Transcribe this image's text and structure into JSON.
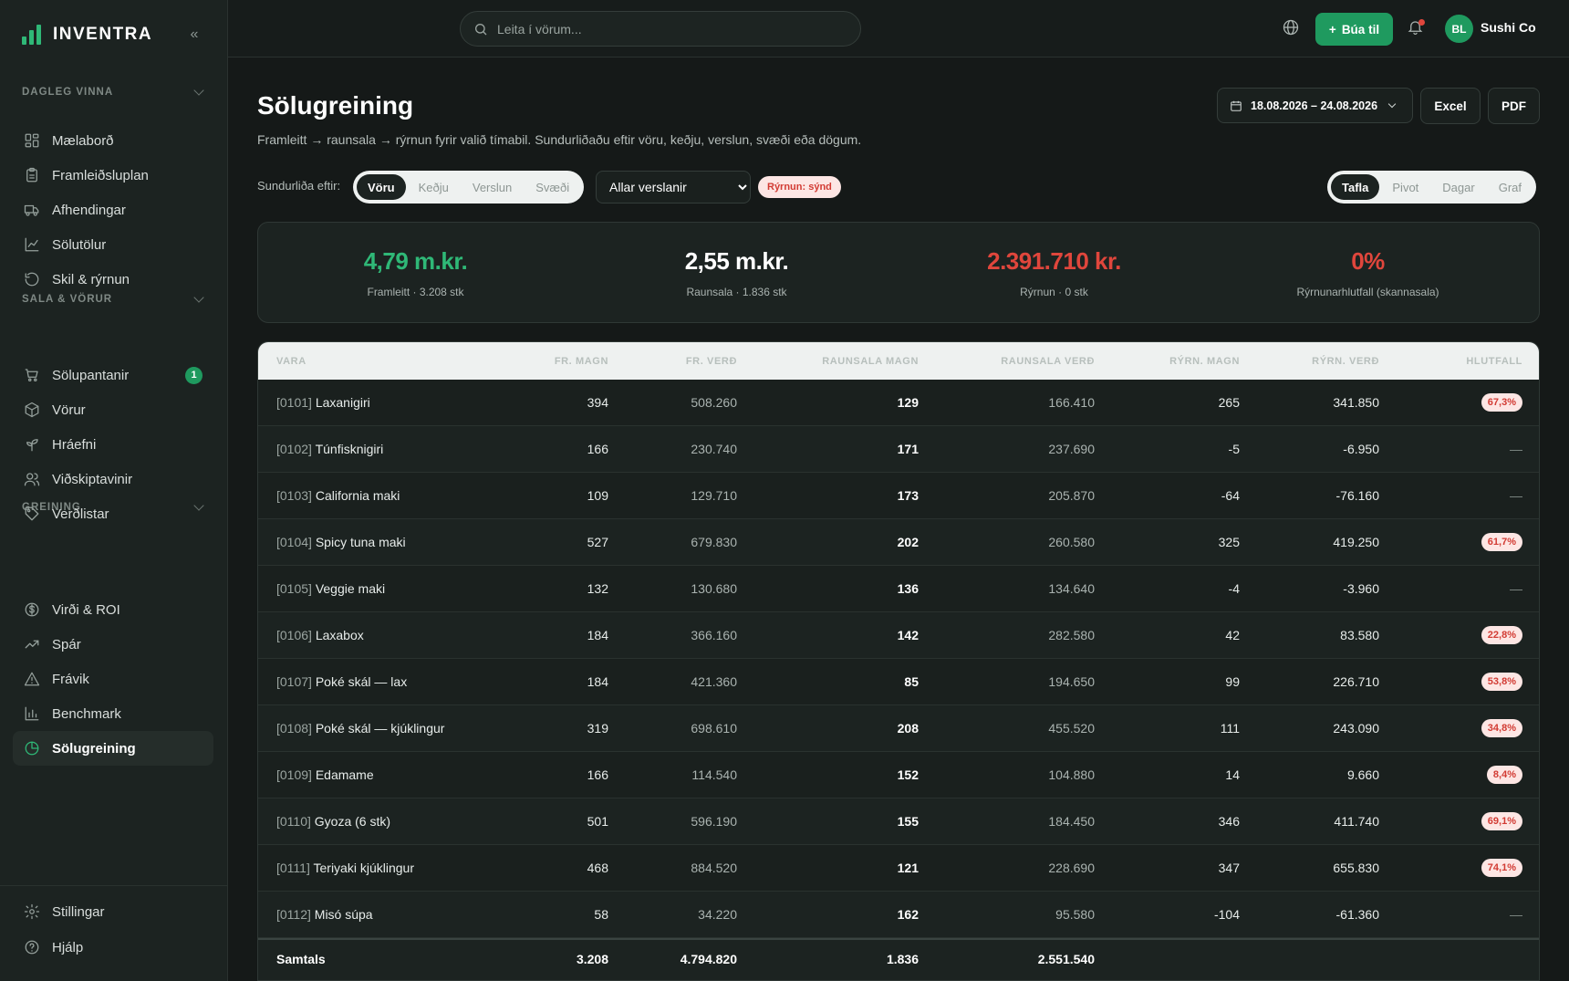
{
  "brand": {
    "name": "INVENTRA"
  },
  "sidebar": {
    "sections": [
      {
        "title": "DAGLEG VINNA"
      },
      {
        "title": "SALA & VÖRUR"
      },
      {
        "title": "GREINING"
      }
    ],
    "items": [
      {
        "label": "Mælaborð",
        "icon": "dashboard-icon"
      },
      {
        "label": "Framleiðsluplan",
        "icon": "clipboard-icon"
      },
      {
        "label": "Afhendingar",
        "icon": "truck-icon"
      },
      {
        "label": "Sölutölur",
        "icon": "line-chart-icon"
      },
      {
        "label": "Skil & rýrnun",
        "icon": "undo-icon"
      },
      {
        "label": "Sölupantanir",
        "icon": "cart-icon",
        "badge": "1"
      },
      {
        "label": "Vörur",
        "icon": "box-icon"
      },
      {
        "label": "Hráefni",
        "icon": "sprout-icon"
      },
      {
        "label": "Viðskiptavinir",
        "icon": "users-icon"
      },
      {
        "label": "Verðlistar",
        "icon": "tag-icon"
      },
      {
        "label": "Virði & ROI",
        "icon": "dollar-icon"
      },
      {
        "label": "Spár",
        "icon": "trend-up-icon"
      },
      {
        "label": "Frávik",
        "icon": "warning-icon"
      },
      {
        "label": "Benchmark",
        "icon": "bar-chart-icon"
      },
      {
        "label": "Sölugreining",
        "icon": "pie-chart-icon",
        "active": true
      }
    ],
    "bottom": [
      {
        "label": "Stillingar",
        "icon": "gear-icon"
      },
      {
        "label": "Hjálp",
        "icon": "help-icon"
      }
    ]
  },
  "topbar": {
    "search_placeholder": "Leita í vörum...",
    "create_label": "Búa til",
    "avatar_initials": "BL",
    "user_name": "Sushi Co"
  },
  "page": {
    "title": "Sölugreining",
    "subtitle": "Framleitt → raunsala → rýrnun fyrir valið tímabil. Sundurliðaðu eftir vöru, keðju, verslun, svæði eða dögum.",
    "date_range": "18.08.2026 – 24.08.2026",
    "export_excel": "Excel",
    "export_pdf": "PDF",
    "breakdown_label": "Sundurliða eftir:",
    "breakdown_options": [
      "Vöru",
      "Keðju",
      "Verslun",
      "Svæði"
    ],
    "store_select": "Allar verslanir",
    "shrink_pill": "Rýrnun: sýnd",
    "view_options": [
      "Tafla",
      "Pivot",
      "Dagar",
      "Graf"
    ]
  },
  "kpis": [
    {
      "value": "4,79 m.kr.",
      "label": "Framleitt · 3.208 stk",
      "color": "#2fb877"
    },
    {
      "value": "2,55 m.kr.",
      "label": "Raunsala · 1.836 stk",
      "color": "#ffffff"
    },
    {
      "value": "2.391.710 kr.",
      "label": "Rýrnun · 0 stk",
      "color": "#e0463c"
    },
    {
      "value": "0%",
      "label": "Rýrnunarhlutfall (skannasala)",
      "color": "#e0463c"
    }
  ],
  "table": {
    "headers": [
      "VARA",
      "FR. MAGN",
      "FR. VERÐ",
      "RAUNSALA MAGN",
      "RAUNSALA VERÐ",
      "RÝRN. MAGN",
      "RÝRN. VERÐ",
      "HLUTFALL"
    ],
    "rows": [
      {
        "code": "[0101]",
        "name": "Laxanigiri",
        "fr_qty": "394",
        "fr_price": "508.260",
        "sale_qty": "129",
        "sale_price": "166.410",
        "shr_qty": "265",
        "shr_price": "341.850",
        "pct": "67,3%"
      },
      {
        "code": "[0102]",
        "name": "Túnfisknigiri",
        "fr_qty": "166",
        "fr_price": "230.740",
        "sale_qty": "171",
        "sale_price": "237.690",
        "shr_qty": "-5",
        "shr_price": "-6.950",
        "pct": "—"
      },
      {
        "code": "[0103]",
        "name": "California maki",
        "fr_qty": "109",
        "fr_price": "129.710",
        "sale_qty": "173",
        "sale_price": "205.870",
        "shr_qty": "-64",
        "shr_price": "-76.160",
        "pct": "—"
      },
      {
        "code": "[0104]",
        "name": "Spicy tuna maki",
        "fr_qty": "527",
        "fr_price": "679.830",
        "sale_qty": "202",
        "sale_price": "260.580",
        "shr_qty": "325",
        "shr_price": "419.250",
        "pct": "61,7%"
      },
      {
        "code": "[0105]",
        "name": "Veggie maki",
        "fr_qty": "132",
        "fr_price": "130.680",
        "sale_qty": "136",
        "sale_price": "134.640",
        "shr_qty": "-4",
        "shr_price": "-3.960",
        "pct": "—"
      },
      {
        "code": "[0106]",
        "name": "Laxabox",
        "fr_qty": "184",
        "fr_price": "366.160",
        "sale_qty": "142",
        "sale_price": "282.580",
        "shr_qty": "42",
        "shr_price": "83.580",
        "pct": "22,8%"
      },
      {
        "code": "[0107]",
        "name": "Poké skál — lax",
        "fr_qty": "184",
        "fr_price": "421.360",
        "sale_qty": "85",
        "sale_price": "194.650",
        "shr_qty": "99",
        "shr_price": "226.710",
        "pct": "53,8%"
      },
      {
        "code": "[0108]",
        "name": "Poké skál — kjúklingur",
        "fr_qty": "319",
        "fr_price": "698.610",
        "sale_qty": "208",
        "sale_price": "455.520",
        "shr_qty": "111",
        "shr_price": "243.090",
        "pct": "34,8%"
      },
      {
        "code": "[0109]",
        "name": "Edamame",
        "fr_qty": "166",
        "fr_price": "114.540",
        "sale_qty": "152",
        "sale_price": "104.880",
        "shr_qty": "14",
        "shr_price": "9.660",
        "pct": "8,4%"
      },
      {
        "code": "[0110]",
        "name": "Gyoza (6 stk)",
        "fr_qty": "501",
        "fr_price": "596.190",
        "sale_qty": "155",
        "sale_price": "184.450",
        "shr_qty": "346",
        "shr_price": "411.740",
        "pct": "69,1%"
      },
      {
        "code": "[0111]",
        "name": "Teriyaki kjúklingur",
        "fr_qty": "468",
        "fr_price": "884.520",
        "sale_qty": "121",
        "sale_price": "228.690",
        "shr_qty": "347",
        "shr_price": "655.830",
        "pct": "74,1%"
      },
      {
        "code": "[0112]",
        "name": "Misó súpa",
        "fr_qty": "58",
        "fr_price": "34.220",
        "sale_qty": "162",
        "sale_price": "95.580",
        "shr_qty": "-104",
        "shr_price": "-61.360",
        "pct": "—"
      }
    ],
    "totals": {
      "label": "Samtals",
      "fr_qty": "3.208",
      "fr_price": "4.794.820",
      "sale_qty": "1.836",
      "sale_price": "2.551.540"
    }
  }
}
